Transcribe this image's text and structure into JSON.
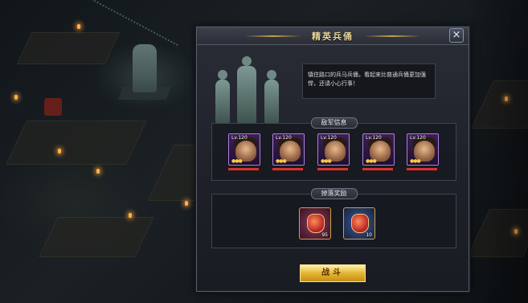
{
  "dialog": {
    "title": "精英兵俑",
    "close_label": "×",
    "description": "镇住路口的兵马兵俑，看起来比普通兵俑更加强悍，还请小心行事！"
  },
  "enemy_section": {
    "label": "敌军信息",
    "enemies": [
      {
        "level": "Lv.120",
        "stars": "●●●",
        "hp": 0.95
      },
      {
        "level": "Lv.120",
        "stars": "●●●",
        "hp": 0.95
      },
      {
        "level": "Lv.120",
        "stars": "●●●",
        "hp": 0.95
      },
      {
        "level": "Lv.120",
        "stars": "●●●",
        "hp": 0.95
      },
      {
        "level": "Lv.120",
        "stars": "●●●",
        "hp": 0.95
      }
    ]
  },
  "reward_section": {
    "label": "掉落奖励",
    "rewards": [
      {
        "icon": "red-pouch-icon",
        "qty": "95"
      },
      {
        "icon": "red-gem-icon",
        "qty": "10"
      }
    ]
  },
  "fight_button": {
    "label": "战斗"
  },
  "colors": {
    "accent": "#e2b534",
    "purple_frame": "#b07de0",
    "hp": "#d8332b"
  }
}
